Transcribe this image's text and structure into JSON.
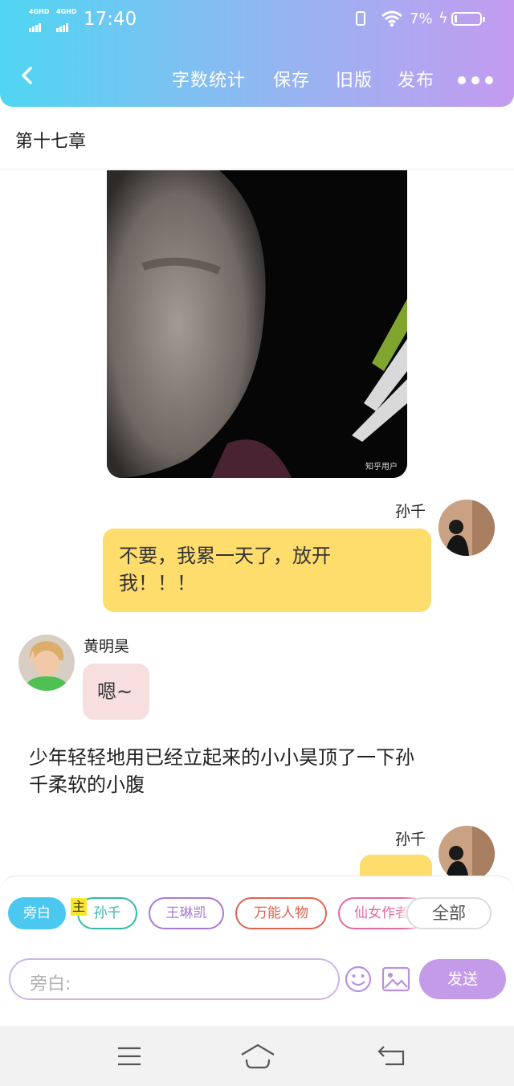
{
  "status_bar": {
    "signal1": "4GHD",
    "signal2": "4GHD",
    "time": "17:40",
    "battery_pct": "7%"
  },
  "toolbar": {
    "word_count": "字数统计",
    "save": "保存",
    "old_version": "旧版",
    "publish": "发布"
  },
  "chapter": {
    "title": "第十七章"
  },
  "photo": {
    "watermark": "知乎用户"
  },
  "messages": [
    {
      "speaker": "孙千",
      "side": "right",
      "text_line1": "不要，我累一天了，放开",
      "text_line2": "我！！！"
    },
    {
      "speaker": "黄明昊",
      "side": "left",
      "text": "嗯~"
    },
    {
      "speaker": "孙千",
      "side": "right",
      "text": ""
    }
  ],
  "narration": {
    "line1": "少年轻轻地用已经立起来的小小昊顶了一下孙",
    "line2": "千柔软的小腹"
  },
  "role_bar": {
    "roles": [
      {
        "label": "旁白",
        "active": true,
        "color": "#4ac8ef"
      },
      {
        "label": "孙千",
        "active": false,
        "color": "#35b9a6"
      },
      {
        "label": "王琳凯",
        "active": false,
        "color": "#a77ad4"
      },
      {
        "label": "万能人物",
        "active": false,
        "color": "#e0624f"
      },
      {
        "label": "仙女作者",
        "active": false,
        "color": "#e56aa0"
      }
    ],
    "host_tag": "主",
    "all_label": "全部"
  },
  "composer": {
    "placeholder": "旁白:",
    "send_label": "发送"
  },
  "icons": {
    "back": "chevron-left-icon",
    "more": "more-dots-icon",
    "emoji": "emoji-icon",
    "image": "image-icon",
    "menu": "menu-icon",
    "home": "home-icon",
    "return": "return-icon"
  },
  "colors": {
    "header_gradient_start": "#4fd6f2",
    "header_gradient_end": "#c49bf0",
    "bubble_yellow": "#fedd6c",
    "bubble_pink": "#f7dfe0",
    "send_button": "#c49be8"
  }
}
